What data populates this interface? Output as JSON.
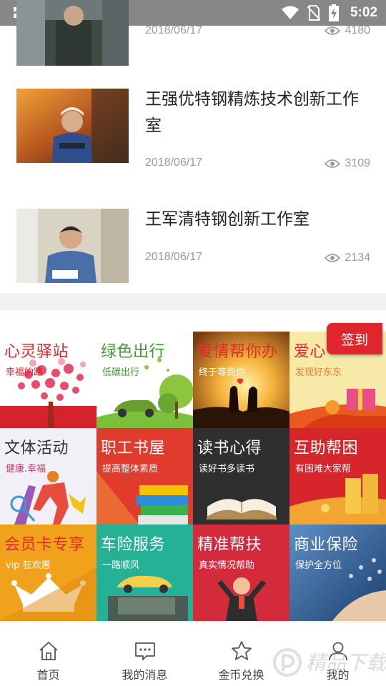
{
  "status_bar": {
    "time": "5:02"
  },
  "articles": [
    {
      "title": "",
      "date": "2018/06/17",
      "views": "4180"
    },
    {
      "title": "王强优特钢精炼技术创新工作室",
      "date": "2018/06/17",
      "views": "3109"
    },
    {
      "title": "王军清特钢创新工作室",
      "date": "2018/06/17",
      "views": "2134"
    }
  ],
  "sign_in": {
    "label": "签到"
  },
  "tiles": [
    {
      "title": "心灵驿站",
      "subtitle": "幸福的路"
    },
    {
      "title": "绿色出行",
      "subtitle": "低碳出行"
    },
    {
      "title": "爱情帮你办",
      "subtitle": "终于等到你"
    },
    {
      "title": "爱心",
      "subtitle": "发现好东东"
    },
    {
      "title": "文体活动",
      "subtitle": "健康.幸福"
    },
    {
      "title": "职工书屋",
      "subtitle": "提高整体素质"
    },
    {
      "title": "读书心得",
      "subtitle": "读好书多读书"
    },
    {
      "title": "互助帮困",
      "subtitle": "有困难大家帮"
    },
    {
      "title": "会员卡专享",
      "subtitle": "vip 狂欢惠"
    },
    {
      "title": "车险服务",
      "subtitle": "一路顺风"
    },
    {
      "title": "精准帮扶",
      "subtitle": "真实情况帮助"
    },
    {
      "title": "商业保险",
      "subtitle": "保护全方位"
    }
  ],
  "tabbar": [
    {
      "label": "首页",
      "icon": "home-icon"
    },
    {
      "label": "我的消息",
      "icon": "message-icon"
    },
    {
      "label": "金币兑换",
      "icon": "star-icon"
    },
    {
      "label": "我的",
      "icon": "user-icon"
    }
  ],
  "watermark": {
    "text": "精品下载"
  }
}
